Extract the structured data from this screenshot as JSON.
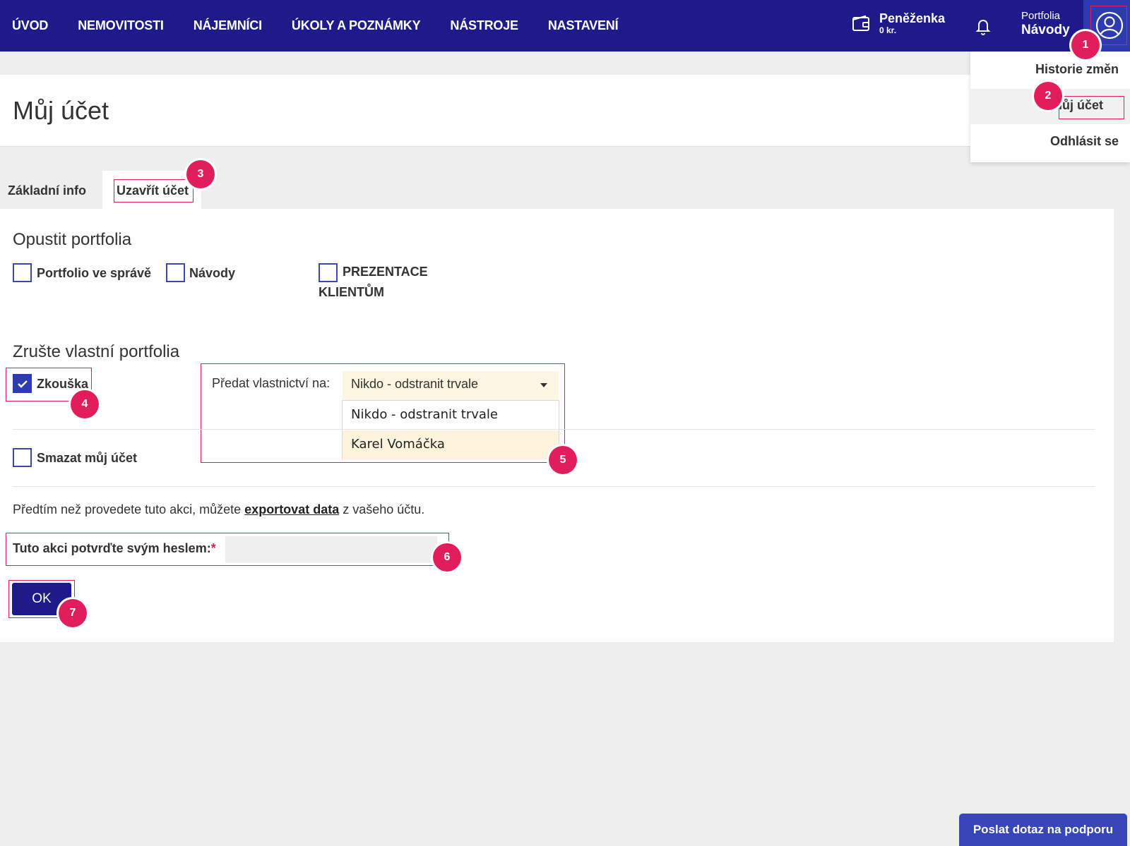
{
  "nav": {
    "items": [
      "ÚVOD",
      "NEMOVITOSTI",
      "NÁJEMNÍCI",
      "ÚKOLY A POZNÁMKY",
      "NÁSTROJE",
      "NASTAVENÍ"
    ],
    "wallet_title": "Peněženka",
    "wallet_amount": "0 kr.",
    "portfolio_label": "Portfolia",
    "portfolio_name": "Návody",
    "user_icon": "user-circle-icon",
    "wallet_icon": "wallet-icon",
    "bell_icon": "bell-icon"
  },
  "user_menu": {
    "items": [
      "Historie změn",
      "Můj účet",
      "Odhlásit se"
    ]
  },
  "page": {
    "title": "Můj účet"
  },
  "tabs": [
    "Základní info",
    "Uzavřít účet"
  ],
  "leave_section": {
    "title": "Opustit portfolia",
    "checkboxes": [
      {
        "label": "Portfolio ve správě",
        "checked": false
      },
      {
        "label": "Návody",
        "checked": false
      },
      {
        "label": "PREZENTACE KLIENTŮM",
        "checked": false
      }
    ]
  },
  "cancel_section": {
    "title": "Zrušte vlastní portfolia",
    "portfolio": {
      "label": "Zkouška",
      "checked": true
    },
    "transfer_label": "Předat vlastnictví na:",
    "transfer_selected": "Nikdo - odstranit trvale",
    "transfer_options": [
      "Nikdo - odstranit trvale",
      "Karel Vomáčka"
    ]
  },
  "delete_account": {
    "label": "Smazat můj účet",
    "checked": false
  },
  "info": {
    "before": "Předtím než provedete tuto akci, můžete ",
    "link": "exportovat data",
    "after": " z vašeho účtu."
  },
  "password": {
    "label": "Tuto akci potvrďte svým heslem:",
    "required_mark": "*",
    "value": ""
  },
  "ok_label": "OK",
  "support_label": "Poslat dotaz na podporu",
  "badges": [
    "1",
    "2",
    "3",
    "4",
    "5",
    "6",
    "7"
  ],
  "colors": {
    "nav_bg": "#1e1a8c",
    "accent": "#2d3ab0",
    "annotation": "#e11d5b",
    "select_bg": "#fdf6e0"
  }
}
